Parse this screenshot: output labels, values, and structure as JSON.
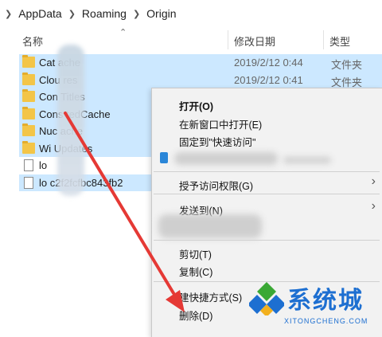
{
  "address": {
    "segments": [
      "AppData",
      "Roaming",
      "Origin"
    ]
  },
  "columns": {
    "name": "名称",
    "date": "修改日期",
    "type": "类型"
  },
  "files": [
    {
      "name": "Cat       ache",
      "date": "2019/2/12 0:44",
      "type": "文件夹",
      "icon": "folder-icon",
      "selected": true
    },
    {
      "name": "Clou       res",
      "date": "2019/2/12 0:41",
      "type": "文件夹",
      "icon": "folder-icon",
      "selected": true
    },
    {
      "name": "Con       Titles",
      "date": "",
      "type": "",
      "icon": "folder-icon",
      "selected": true
    },
    {
      "name": "Cons       tedCache",
      "date": "",
      "type": "",
      "icon": "folder-icon",
      "selected": true
    },
    {
      "name": "Nuc       ache",
      "date": "",
      "type": "",
      "icon": "folder-icon",
      "selected": true
    },
    {
      "name": "Wi       Updates",
      "date": "",
      "type": "",
      "icon": "folder-icon",
      "selected": true
    },
    {
      "name": "lo",
      "date": "",
      "type": "",
      "icon": "file-icon",
      "selected": false
    },
    {
      "name": "lo       c2f2fcfbc843fb2",
      "date": "",
      "type": "",
      "icon": "file-icon",
      "selected": true
    }
  ],
  "context_menu": {
    "open": "打开(O)",
    "open_new_window": "在新窗口中打开(E)",
    "pin_quick_access": "固定到\"快速访问\"",
    "grant_access": "授予访问权限(G)",
    "send_to": "发送到(N)",
    "cut": "剪切(T)",
    "copy": "复制(C)",
    "create_shortcut": "建快捷方式(S)",
    "delete": "删除(D)"
  },
  "watermark": {
    "title": "系统城",
    "subtitle": "XITONGCHENG.COM"
  },
  "colors": {
    "selection": "#cce8ff",
    "arrow": "#e53935",
    "watermark": "#1d6fd1"
  }
}
